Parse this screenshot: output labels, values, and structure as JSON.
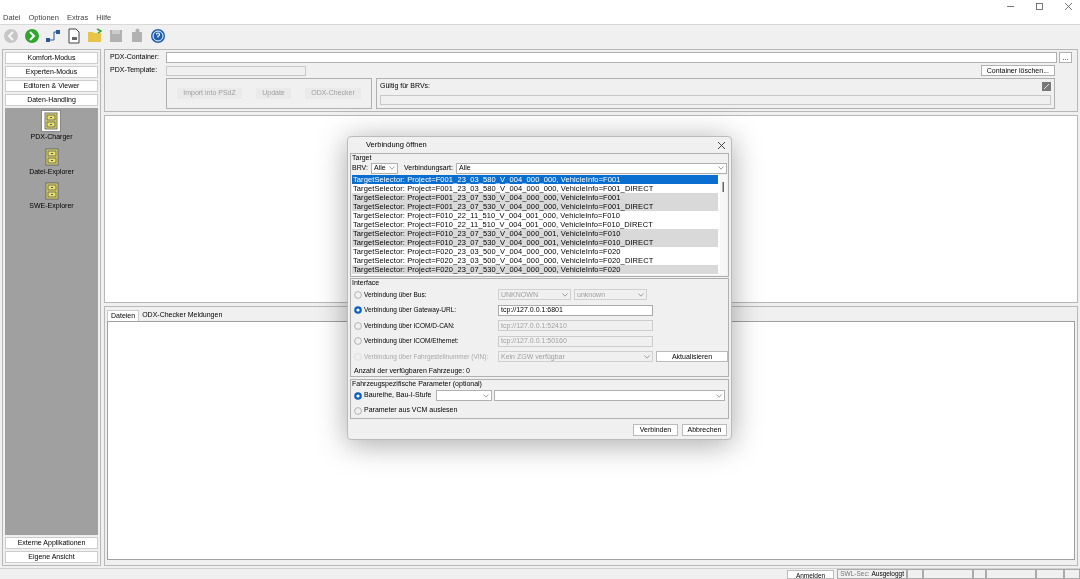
{
  "menu": [
    "Datei",
    "Optionen",
    "Extras",
    "Hilfe"
  ],
  "toolbar": [
    {
      "kind": "back",
      "disabled": true
    },
    {
      "kind": "forward",
      "disabled": false
    },
    {
      "kind": "flow",
      "disabled": false
    },
    {
      "kind": "document",
      "disabled": false
    },
    {
      "kind": "open",
      "disabled": false
    },
    {
      "kind": "save",
      "disabled": true
    },
    {
      "kind": "puzzle",
      "disabled": true
    },
    {
      "kind": "help",
      "disabled": false
    }
  ],
  "sidebar": {
    "modes": [
      "Komfort-Modus",
      "Experten-Modus",
      "Editoren & Viewer",
      "Daten-Handling"
    ],
    "tools": [
      {
        "label": "PDX-Charger",
        "selected": true
      },
      {
        "label": "Datei-Explorer",
        "selected": false
      },
      {
        "label": "SWE-Explorer",
        "selected": false
      }
    ],
    "bottom": [
      "Externe Applikationen",
      "Eigene Ansicht"
    ]
  },
  "pdx": {
    "container_label": "PDX-Container:",
    "browse_button": "...",
    "template_label": "PDX-Template:",
    "clear_button": "Container löschen...",
    "buttons": [
      {
        "label": "Import into PSdZ",
        "disabled": true
      },
      {
        "label": "Update",
        "disabled": true
      },
      {
        "label": "ODX-Checker",
        "disabled": true
      }
    ],
    "brv_label": "Gültig für BRVs:"
  },
  "bottom_tabs": [
    {
      "label": "Dateien",
      "selected": true
    },
    {
      "label": "ODX-Checker Meldungen",
      "selected": false
    }
  ],
  "dialog": {
    "title": "Verbindung öffnen",
    "target_legend": "Target",
    "brv_label": "BRV:",
    "brv_value": "Alle",
    "art_label": "Verbindungsart:",
    "art_value": "Alle",
    "targets": [
      {
        "text": "TargetSelector: Project=F001_23_03_580_V_004_000_000, VehicleInfo=F001",
        "selected": true,
        "shaded": false
      },
      {
        "text": "TargetSelector: Project=F001_23_03_580_V_004_000_000, VehicleInfo=F001_DIRECT",
        "selected": false,
        "shaded": false
      },
      {
        "text": "TargetSelector: Project=F001_23_07_530_V_004_000_000, VehicleInfo=F001",
        "selected": false,
        "shaded": true
      },
      {
        "text": "TargetSelector: Project=F001_23_07_530_V_004_000_000, VehicleInfo=F001_DIRECT",
        "selected": false,
        "shaded": true
      },
      {
        "text": "TargetSelector: Project=F010_22_11_510_V_004_001_000, VehicleInfo=F010",
        "selected": false,
        "shaded": false
      },
      {
        "text": "TargetSelector: Project=F010_22_11_510_V_004_001_000, VehicleInfo=F010_DIRECT",
        "selected": false,
        "shaded": false
      },
      {
        "text": "TargetSelector: Project=F010_23_07_530_V_004_000_001, VehicleInfo=F010",
        "selected": false,
        "shaded": true
      },
      {
        "text": "TargetSelector: Project=F010_23_07_530_V_004_000_001, VehicleInfo=F010_DIRECT",
        "selected": false,
        "shaded": true
      },
      {
        "text": "TargetSelector: Project=F020_23_03_500_V_004_000_000, VehicleInfo=F020",
        "selected": false,
        "shaded": false
      },
      {
        "text": "TargetSelector: Project=F020_23_03_500_V_004_000_000, VehicleInfo=F020_DIRECT",
        "selected": false,
        "shaded": false
      },
      {
        "text": "TargetSelector: Project=F020_23_07_530_V_004_000_000, VehicleInfo=F020",
        "selected": false,
        "shaded": true
      }
    ],
    "interface_legend": "Interface",
    "interfaces": [
      {
        "label": "Verbindung über Bus:",
        "selected": false,
        "disabled": false,
        "kind": "combos",
        "values": [
          "UNKNOWN",
          "unknown"
        ],
        "value_disabled": true
      },
      {
        "label": "Verbindung über Gateway-URL:",
        "selected": true,
        "disabled": false,
        "kind": "field",
        "value": "tcp://127.0.0.1:6801",
        "value_disabled": false
      },
      {
        "label": "Verbindung über ICOM/D-CAN:",
        "selected": false,
        "disabled": false,
        "kind": "field",
        "value": "tcp://127.0.0.1:52410",
        "value_disabled": true
      },
      {
        "label": "Verbindung über ICOM/Ethernet:",
        "selected": false,
        "disabled": false,
        "kind": "field",
        "value": "tcp://127.0.0.1:50160",
        "value_disabled": true
      },
      {
        "label": "Verbindung über Fahrgestellnummer (VIN):",
        "selected": false,
        "disabled": true,
        "kind": "combo_button",
        "value": "Kein ZGW verfügbar",
        "value_disabled": true,
        "button": "Aktualisieren"
      }
    ],
    "vehicle_count": "Anzahl der verfügbaren Fahrzeuge: 0",
    "params_legend": "Fahrzeugspezifische Parameter (optional)",
    "params": [
      {
        "label": "Baureihe, Bau-I-Stufe",
        "selected": true,
        "kind": "combos"
      },
      {
        "label": "Parameter aus VCM auslesen",
        "selected": false,
        "kind": "plain"
      }
    ],
    "buttons": [
      "Verbinden",
      "Abbrechen"
    ]
  },
  "status_bar": {
    "login_button": "Anmelden",
    "sec_label": "SWL-Sec:",
    "sec_value": "Ausgeloggt"
  }
}
